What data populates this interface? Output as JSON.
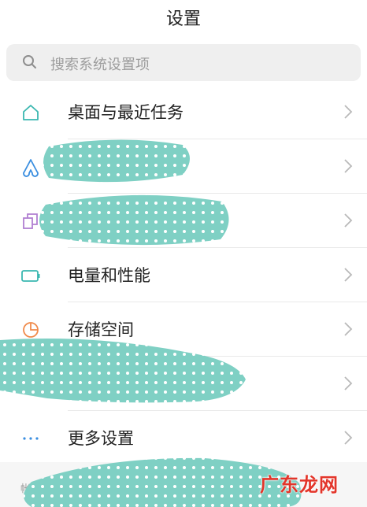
{
  "header": {
    "title": "设置"
  },
  "search": {
    "placeholder": "搜索系统设置项"
  },
  "rows": [
    {
      "label": "桌面与最近任务",
      "icon": "home-icon"
    },
    {
      "label": "",
      "icon": "theme-icon"
    },
    {
      "label": "",
      "icon": "multi-window-icon"
    },
    {
      "label": "电量和性能",
      "icon": "battery-icon"
    },
    {
      "label": "存储空间",
      "icon": "storage-pie-icon"
    },
    {
      "label": "",
      "icon": "circle-icon"
    },
    {
      "label": "更多设置",
      "icon": "more-dots-icon"
    }
  ],
  "section": {
    "label": "帐号"
  },
  "watermark": "广东龙网",
  "colors": {
    "accent": "#3ab7b0",
    "icon_purple": "#b17fd1",
    "icon_orange": "#f08a4b",
    "icon_red": "#ef5a5a",
    "scribble": "#7fd0c4"
  }
}
